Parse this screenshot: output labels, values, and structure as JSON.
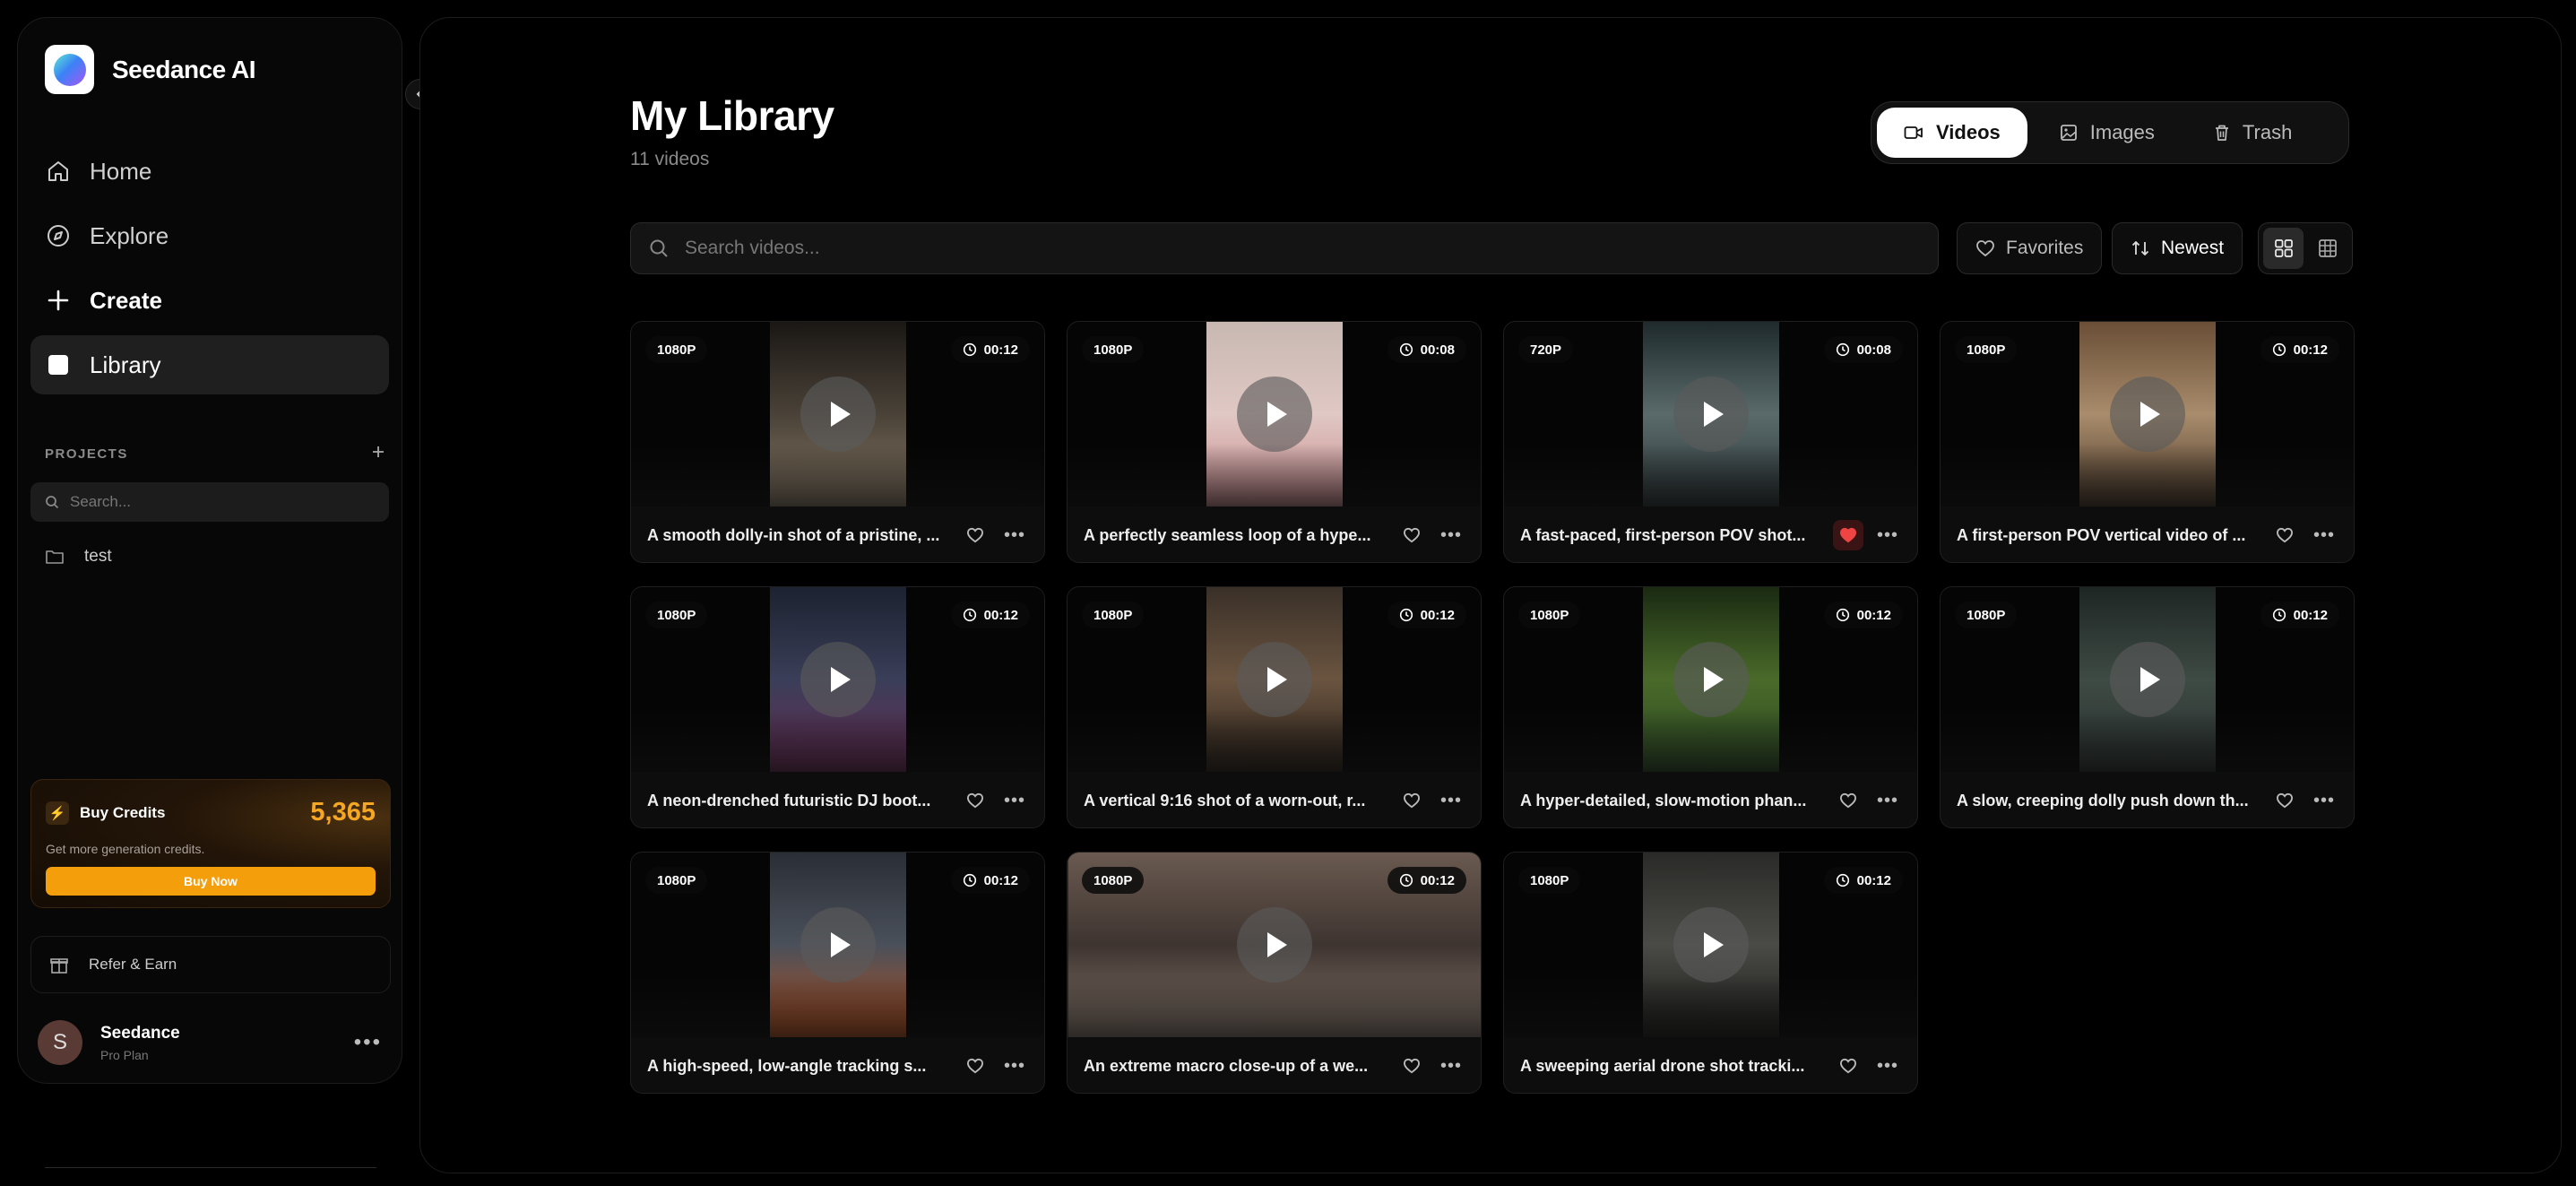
{
  "app": {
    "name": "Seedance AI"
  },
  "sidebar": {
    "nav": [
      {
        "label": "Home",
        "icon": "home-icon"
      },
      {
        "label": "Explore",
        "icon": "compass-icon"
      },
      {
        "label": "Create",
        "icon": "plus-icon"
      },
      {
        "label": "Library",
        "icon": "library-icon",
        "active": true
      }
    ],
    "projects_label": "PROJECTS",
    "projects_search_placeholder": "Search...",
    "projects": [
      {
        "name": "test"
      }
    ],
    "credits": {
      "title": "Buy Credits",
      "amount": "5,365",
      "subtitle": "Get more generation credits.",
      "button": "Buy Now",
      "accent": "#f59e0b"
    },
    "refer_label": "Refer & Earn",
    "user": {
      "name": "Seedance",
      "plan": "Pro Plan",
      "initial": "S"
    }
  },
  "page": {
    "title": "My Library",
    "subtitle": "11 videos",
    "tabs": [
      {
        "label": "Videos",
        "icon": "video-icon",
        "active": true
      },
      {
        "label": "Images",
        "icon": "image-icon"
      },
      {
        "label": "Trash",
        "icon": "trash-icon"
      }
    ],
    "search_placeholder": "Search videos...",
    "favorites_label": "Favorites",
    "sort_label": "Newest",
    "view_mode": "grid"
  },
  "videos": [
    {
      "resolution": "1080P",
      "duration": "00:12",
      "caption": "A smooth dolly-in shot of a pristine, ...",
      "favorite": false,
      "thumb": [
        "#1a1714",
        "#4a4238",
        "#8a7a66"
      ]
    },
    {
      "resolution": "1080P",
      "duration": "00:08",
      "caption": "A perfectly seamless loop of a hype...",
      "favorite": false,
      "thumb": [
        "#c8b8b2",
        "#e0c8c4",
        "#c98a8e"
      ]
    },
    {
      "resolution": "720P",
      "duration": "00:08",
      "caption": "A fast-paced, first-person POV shot...",
      "favorite": true,
      "thumb": [
        "#1e2a2c",
        "#5a6a6a",
        "#2a3436"
      ]
    },
    {
      "resolution": "1080P",
      "duration": "00:12",
      "caption": "A first-person POV vertical video of ...",
      "favorite": false,
      "thumb": [
        "#6a4e36",
        "#a98c6c",
        "#4a3828"
      ]
    },
    {
      "resolution": "1080P",
      "duration": "00:12",
      "caption": "A neon-drenched futuristic DJ boot...",
      "favorite": false,
      "thumb": [
        "#1c2230",
        "#3a3e58",
        "#6a2c58"
      ]
    },
    {
      "resolution": "1080P",
      "duration": "00:12",
      "caption": "A vertical 9:16 shot of a worn-out, r...",
      "favorite": false,
      "thumb": [
        "#3a3028",
        "#6a5440",
        "#2a2018"
      ]
    },
    {
      "resolution": "1080P",
      "duration": "00:12",
      "caption": "A hyper-detailed, slow-motion phan...",
      "favorite": false,
      "thumb": [
        "#1a2a12",
        "#4a6a2a",
        "#2a4a22"
      ]
    },
    {
      "resolution": "1080P",
      "duration": "00:12",
      "caption": "A slow, creeping dolly push down th...",
      "favorite": false,
      "thumb": [
        "#1e2624",
        "#3e4a44",
        "#2a3230"
      ]
    },
    {
      "resolution": "1080P",
      "duration": "00:12",
      "caption": "A high-speed, low-angle tracking s...",
      "favorite": false,
      "thumb": [
        "#2a2e36",
        "#4a505a",
        "#b8501e"
      ]
    },
    {
      "resolution": "1080P",
      "duration": "00:12",
      "caption": "An extreme macro close-up of a we...",
      "favorite": false,
      "thumb": [
        "#6a5a50",
        "#3e3430",
        "#8a7a6e"
      ]
    },
    {
      "resolution": "1080P",
      "duration": "00:12",
      "caption": "A sweeping aerial drone shot tracki...",
      "favorite": false,
      "thumb": [
        "#2a2a28",
        "#4a4a46",
        "#1a1a18"
      ]
    }
  ]
}
